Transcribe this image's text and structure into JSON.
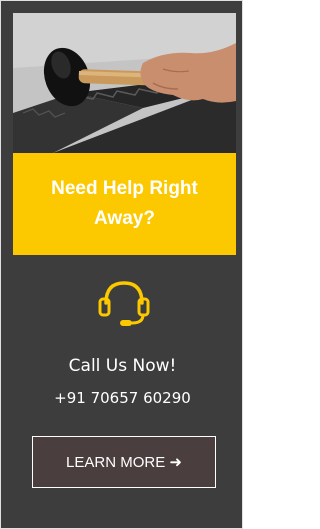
{
  "banner": {
    "title": "Need Help Right Away?"
  },
  "contact": {
    "icon": "headset-icon",
    "title": "Call Us Now!",
    "phone": "+91 70657 60290"
  },
  "cta": {
    "label": "LEARN MORE ➜"
  },
  "colors": {
    "card_background": "#3d3d3d",
    "accent_yellow": "#fcc800",
    "button_background": "#4a3f3e",
    "text": "#ffffff"
  }
}
